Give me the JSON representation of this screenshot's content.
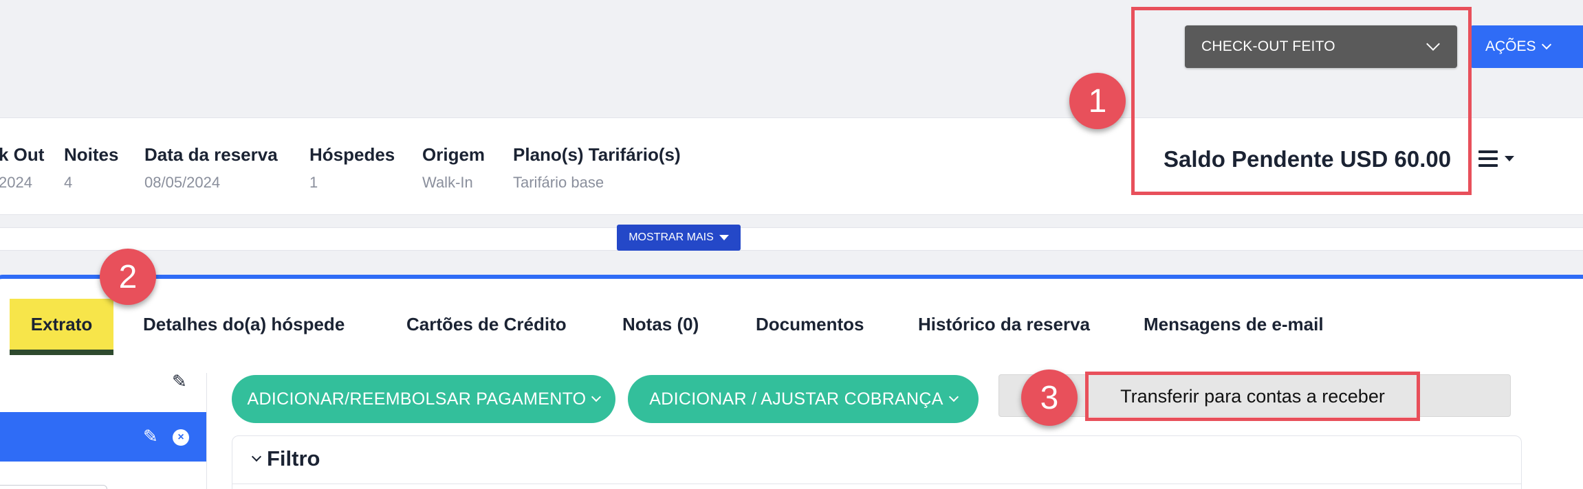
{
  "header": {
    "status_label": "CHECK-OUT FEITO",
    "actions_label": "AÇÕES"
  },
  "reservation": {
    "fields": [
      {
        "label": "k Out",
        "value": "2024"
      },
      {
        "label": "Noites",
        "value": "4"
      },
      {
        "label": "Data da reserva",
        "value": "08/05/2024"
      },
      {
        "label": "Hóspedes",
        "value": "1"
      },
      {
        "label": "Origem",
        "value": "Walk-In"
      },
      {
        "label": "Plano(s) Tarifário(s)",
        "value": "Tarifário base"
      }
    ],
    "balance": "Saldo Pendente USD 60.00",
    "show_more": "MOSTRAR MAIS"
  },
  "tabs": [
    {
      "label": "Extrato"
    },
    {
      "label": "Detalhes do(a) hóspede"
    },
    {
      "label": "Cartões de Crédito"
    },
    {
      "label": "Notas (0)"
    },
    {
      "label": "Documentos"
    },
    {
      "label": "Histórico da reserva"
    },
    {
      "label": "Mensagens de e-mail"
    }
  ],
  "folio": {
    "add_payment_label": "ADICIONAR/REEMBOLSAR PAGAMENTO",
    "add_charge_label": "ADICIONAR / AJUSTAR COBRANÇA",
    "transfer_label": "Transferir para contas a receber",
    "filter_title": "Filtro"
  },
  "annotations": {
    "one": "1",
    "two": "2",
    "three": "3"
  },
  "colors": {
    "highlight": "#e8505b",
    "primary": "#2f6cf6",
    "green": "#33bf9b",
    "active_tab": "#f7e54a"
  },
  "icons": [
    "chevron-down-icon",
    "hamburger-menu-icon",
    "pencil-icon",
    "close-circle-icon"
  ]
}
